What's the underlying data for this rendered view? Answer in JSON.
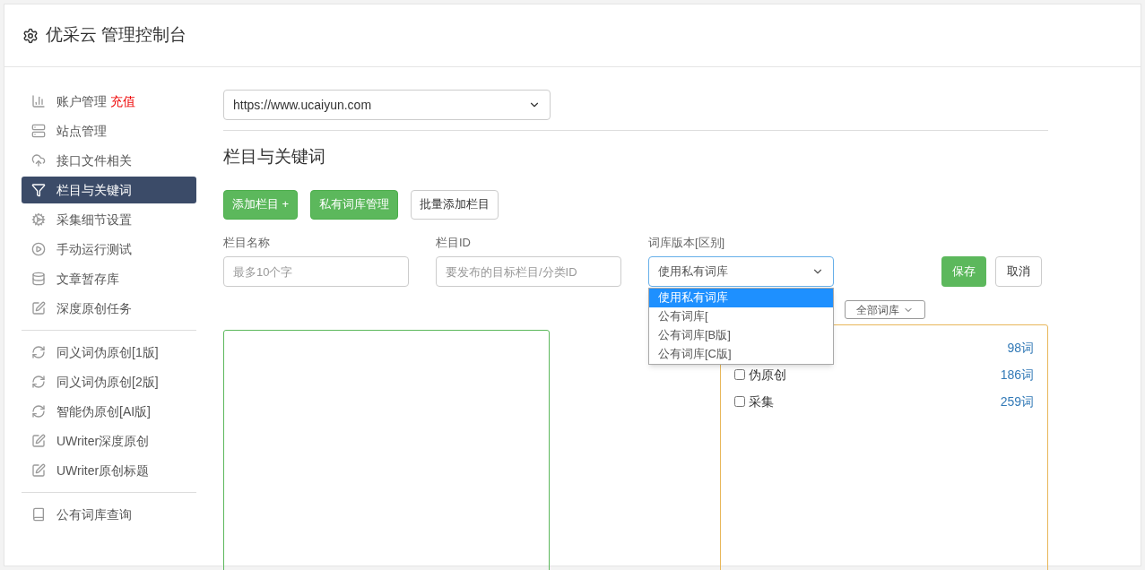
{
  "header": {
    "title": "优采云 管理控制台"
  },
  "sidebar": {
    "groups": [
      {
        "items": [
          {
            "kind": "chart",
            "label": "账户管理",
            "badge": "充值",
            "selected": false
          },
          {
            "kind": "server",
            "label": "站点管理",
            "selected": false
          },
          {
            "kind": "cloud",
            "label": "接口文件相关",
            "selected": false
          },
          {
            "kind": "filter",
            "label": "栏目与关键词",
            "selected": true
          },
          {
            "kind": "gears",
            "label": "采集细节设置",
            "selected": false
          },
          {
            "kind": "play",
            "label": "手动运行测试",
            "selected": false
          },
          {
            "kind": "database",
            "label": "文章暂存库",
            "selected": false
          },
          {
            "kind": "edit",
            "label": "深度原创任务",
            "selected": false
          }
        ]
      },
      {
        "items": [
          {
            "kind": "refresh",
            "label": "同义词伪原创[1版]",
            "selected": false
          },
          {
            "kind": "refresh",
            "label": "同义词伪原创[2版]",
            "selected": false
          },
          {
            "kind": "refresh",
            "label": "智能伪原创[AI版]",
            "selected": false
          },
          {
            "kind": "edit",
            "label": "UWriter深度原创",
            "selected": false
          },
          {
            "kind": "edit",
            "label": "UWriter原创标题",
            "selected": false
          }
        ]
      },
      {
        "items": [
          {
            "kind": "book",
            "label": "公有词库查询",
            "selected": false
          }
        ]
      }
    ]
  },
  "site_select": {
    "value": "https://www.ucaiyun.com"
  },
  "section_title": "栏目与关键词",
  "buttons": [
    {
      "kind": "success",
      "label": "添加栏目 +"
    },
    {
      "kind": "success",
      "label": "私有词库管理"
    },
    {
      "kind": "default",
      "label": "批量添加栏目"
    }
  ],
  "form": {
    "fields": [
      {
        "label": "栏目名称",
        "placeholder": "最多10个字"
      },
      {
        "label": "栏目ID",
        "placeholder": "要发布的目标栏目/分类ID"
      }
    ],
    "library": {
      "label": "词库版本[区别]",
      "value": "使用私有词库",
      "options": [
        {
          "label": "使用私有词库",
          "selected": true
        },
        {
          "label": "公有词库[",
          "selected": false
        },
        {
          "label": "公有词库[B版]",
          "selected": false
        },
        {
          "label": "公有词库[C版]",
          "selected": false
        }
      ]
    },
    "save": "保存",
    "cancel": "取消"
  },
  "filter_select": {
    "value": "全部词库"
  },
  "libraries": [
    {
      "count": "98词"
    },
    {
      "label": "伪原创",
      "count": "186词",
      "checked": false
    },
    {
      "label": "采集",
      "count": "259词",
      "checked": false
    }
  ]
}
